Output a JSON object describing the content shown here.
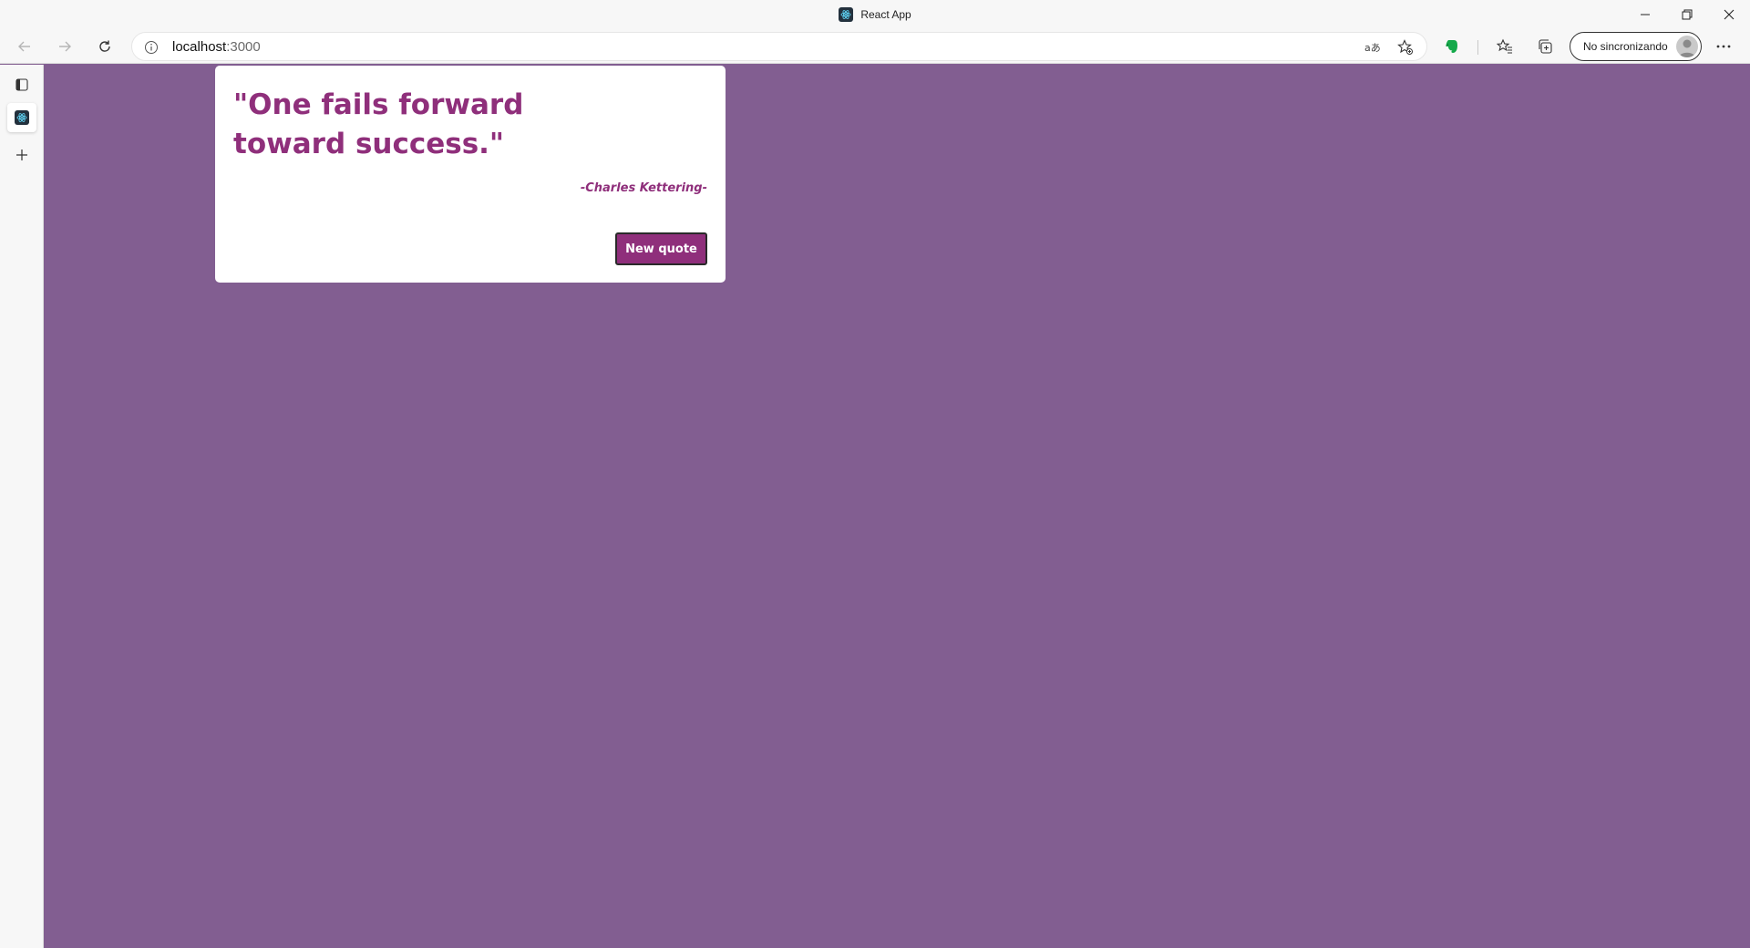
{
  "window": {
    "title": "React App",
    "controls": {
      "minimize": "—",
      "restore": "❐",
      "close": "✕"
    }
  },
  "toolbar": {
    "address": {
      "host": "localhost",
      "port": ":3000"
    },
    "profile_label": "No sincronizando",
    "icons": [
      "back-icon",
      "forward-icon",
      "refresh-icon",
      "site-info-icon",
      "read-aloud-icon",
      "favorite-add-icon",
      "evernote-icon",
      "favorites-icon",
      "collections-icon",
      "more-icon"
    ]
  },
  "rail": {
    "items": [
      "tab-actions-icon",
      "react-tab-favicon",
      "new-tab-icon"
    ]
  },
  "quote": {
    "text": "\"One fails forward toward success.\"",
    "author": "-Charles Kettering-",
    "button_label": "New quote"
  },
  "colors": {
    "background": "#825e91",
    "accent": "#8f2f7b",
    "card": "#ffffff"
  }
}
